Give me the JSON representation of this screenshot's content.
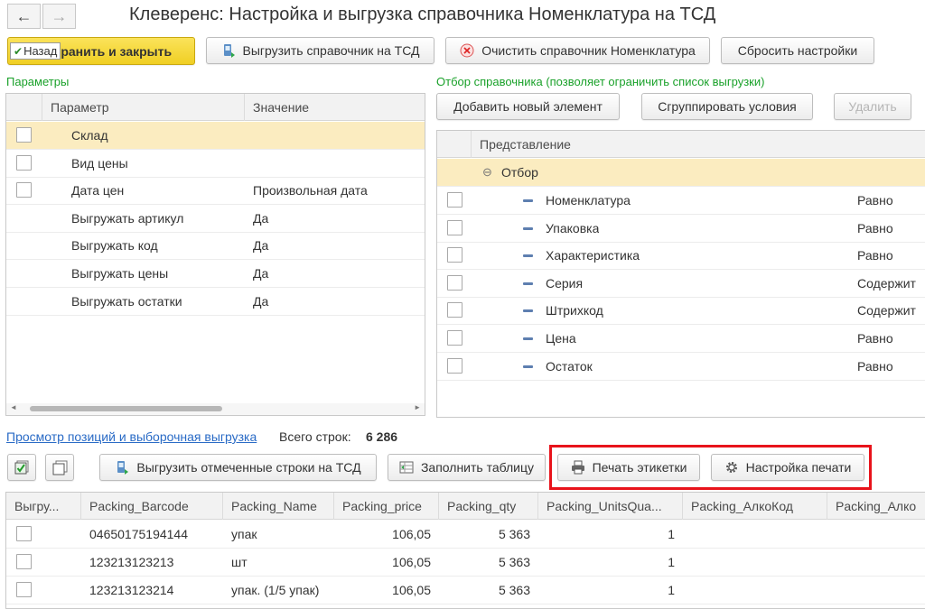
{
  "window": {
    "title": "Клеверенс: Настройка и выгрузка справочника Номенклатура на ТСД"
  },
  "nav": {
    "back": "←",
    "forward": "→"
  },
  "toolbar": {
    "back_label": "Назад",
    "save_close": "ранить и закрыть",
    "upload": "Выгрузить справочник на ТСД",
    "clear": "Очистить справочник Номенклатура",
    "reset": "Сбросить настройки"
  },
  "params": {
    "section_label": "Параметры",
    "col_param": "Параметр",
    "col_value": "Значение",
    "rows": [
      {
        "name": "Склад",
        "value": "",
        "checkbox": true
      },
      {
        "name": "Вид цены",
        "value": "",
        "checkbox": true
      },
      {
        "name": "Дата цен",
        "value": "Произвольная дата",
        "checkbox": true
      },
      {
        "name": "Выгружать артикул",
        "value": "Да",
        "checkbox": false
      },
      {
        "name": "Выгружать код",
        "value": "Да",
        "checkbox": false
      },
      {
        "name": "Выгружать цены",
        "value": "Да",
        "checkbox": false
      },
      {
        "name": "Выгружать остатки",
        "value": "Да",
        "checkbox": false
      }
    ]
  },
  "filter": {
    "section_label": "Отбор справочника (позволяет ограничить список выгрузки)",
    "add_btn": "Добавить новый элемент",
    "group_btn": "Сгруппировать условия",
    "delete_btn": "Удалить",
    "col_repr": "Представление",
    "group_row": "Отбор",
    "collapse_glyph": "⊖",
    "rows": [
      {
        "name": "Номенклатура",
        "cond": "Равно"
      },
      {
        "name": "Упаковка",
        "cond": "Равно"
      },
      {
        "name": "Характеристика",
        "cond": "Равно"
      },
      {
        "name": "Серия",
        "cond": "Содержит"
      },
      {
        "name": "Штрихкод",
        "cond": "Содержит"
      },
      {
        "name": "Цена",
        "cond": "Равно"
      },
      {
        "name": "Остаток",
        "cond": "Равно"
      }
    ]
  },
  "preview": {
    "link": "Просмотр позиций и выборочная выгрузка",
    "total_label": "Всего строк:",
    "total_value": "6 286",
    "upload_marked": "Выгрузить отмеченные строки на ТСД",
    "fill_table": "Заполнить таблицу",
    "print_labels": "Печать этикетки",
    "print_settings": "Настройка печати",
    "columns": [
      "Выгру...",
      "Packing_Barcode",
      "Packing_Name",
      "Packing_price",
      "Packing_qty",
      "Packing_UnitsQua...",
      "Packing_АлкоКод",
      "Packing_Алко"
    ],
    "rows": [
      {
        "barcode": "04650175194144",
        "name": "упак",
        "price": "106,05",
        "qty": "5 363",
        "units": "1"
      },
      {
        "barcode": "123213123213",
        "name": "шт",
        "price": "106,05",
        "qty": "5 363",
        "units": "1"
      },
      {
        "barcode": "123213123214",
        "name": "упак. (1/5 упак)",
        "price": "106,05",
        "qty": "5 363",
        "units": "1"
      }
    ]
  },
  "colors": {
    "accent_green": "#1aa12a",
    "highlight": "#e8131b",
    "primary_yellow": "#f5d735",
    "selection": "#fbecc0",
    "link": "#2a6bc6"
  }
}
